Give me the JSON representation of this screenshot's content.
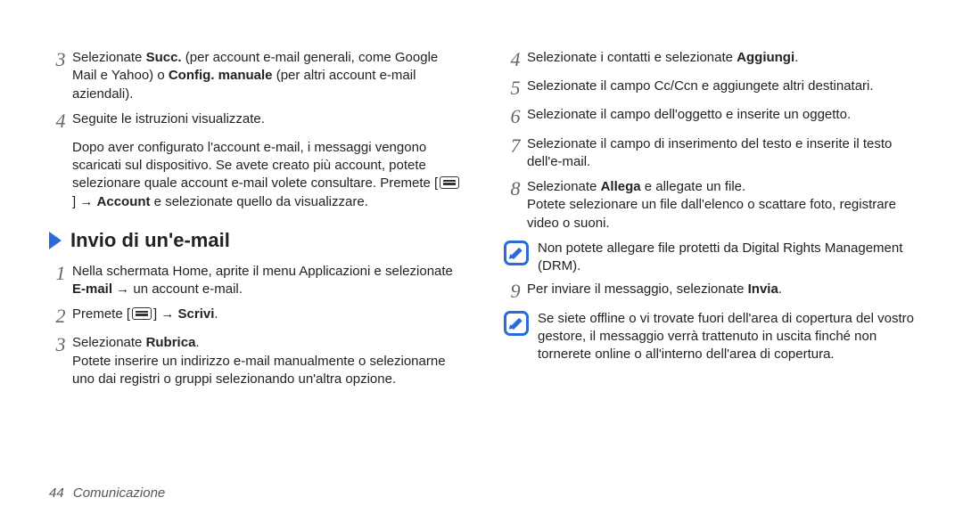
{
  "left": {
    "step3": {
      "prefix": "Selezionate ",
      "succ": "Succ.",
      "mid1": " (per account e-mail generali, come Google Mail e Yahoo) o ",
      "conf": "Config. manuale",
      "suffix": " (per altri account e-mail aziendali)."
    },
    "step4": "Seguite le istruzioni visualizzate.",
    "para": {
      "p1": "Dopo aver configurato l'account e-mail, i messaggi vengono scaricati sul dispositivo. Se avete creato più account, potete selezionare quale account e-mail volete consultare. Premete [",
      "arrow": "] → ",
      "acct": "Account",
      "p2": " e selezionate quello da visualizzare."
    },
    "heading": "Invio di un'e-mail",
    "i1": {
      "p1": "Nella schermata Home, aprite il menu Applicazioni e selezionate ",
      "email": "E-mail",
      "p2": " → un account e-mail."
    },
    "i2": {
      "p1": "Premete [",
      "arrow": "] → ",
      "scrivi": "Scrivi",
      "p2": "."
    },
    "i3": {
      "p1": "Selezionate ",
      "rub": "Rubrica",
      "p2": ".",
      "body": "Potete inserire un indirizzo e-mail manualmente o selezionarne uno dai registri o gruppi selezionando un'altra opzione."
    }
  },
  "right": {
    "i4": {
      "p1": "Selezionate i contatti e selezionate ",
      "agg": "Aggiungi",
      "p2": "."
    },
    "i5": "Selezionate il campo Cc/Ccn e aggiungete altri destinatari.",
    "i6": "Selezionate il campo dell'oggetto e inserite un oggetto.",
    "i7": "Selezionate il campo di inserimento del testo e inserite il testo dell'e-mail.",
    "i8": {
      "p1": "Selezionate ",
      "allega": "Allega",
      "p2": " e allegate un file.",
      "body": "Potete selezionare un file dall'elenco o scattare foto, registrare video o suoni."
    },
    "note1": "Non potete allegare file protetti da Digital Rights Management (DRM).",
    "i9": {
      "p1": "Per inviare il messaggio, selezionate ",
      "invia": "Invia",
      "p2": "."
    },
    "note2": "Se siete offline o vi trovate fuori dell'area di copertura del vostro gestore, il messaggio verrà trattenuto in uscita finché non tornerete online o all'interno dell'area di copertura."
  },
  "footer": {
    "page": "44",
    "section": "Comunicazione"
  }
}
